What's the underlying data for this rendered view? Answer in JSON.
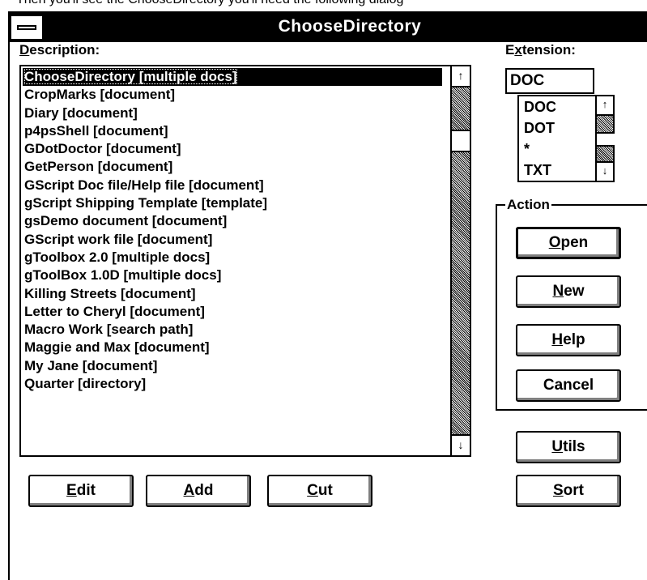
{
  "top_text": "Then you'll see the ChooseDirectory you'll need the following dialog",
  "window": {
    "title": "ChooseDirectory"
  },
  "labels": {
    "description_pre": "",
    "description_key": "D",
    "description_post": "escription:",
    "extension_pre": "E",
    "extension_key": "x",
    "extension_post": "tension:",
    "action": "Action"
  },
  "description_list": {
    "selected_index": 0,
    "items": [
      "ChooseDirectory [multiple docs]",
      "CropMarks [document]",
      "Diary  [document]",
      "p4psShell [document]",
      "GDotDoctor [document]",
      "GetPerson [document]",
      "GScript Doc file/Help file [document]",
      "gScript Shipping Template [template]",
      "gsDemo document [document]",
      "GScript work file [document]",
      "gToolbox 2.0 [multiple docs]",
      "gToolBox 1.0D [multiple docs]",
      "Killing Streets [document]",
      "Letter to Cheryl [document]",
      "Macro Work [search path]",
      "Maggie and Max [document]",
      "My Jane [document]",
      "Quarter [directory]"
    ]
  },
  "extension": {
    "value": "DOC",
    "options": [
      "DOC",
      "DOT",
      "*",
      "TXT"
    ]
  },
  "buttons": {
    "open_key": "O",
    "open_rest": "pen",
    "new_key": "N",
    "new_rest": "ew",
    "help_key": "H",
    "help_rest": "elp",
    "cancel": "Cancel",
    "utils_key": "U",
    "utils_rest": "tils",
    "sort_key": "S",
    "sort_rest": "ort",
    "edit_key": "E",
    "edit_rest": "dit",
    "add_key": "A",
    "add_rest": "dd",
    "cut_key": "C",
    "cut_rest": "ut"
  },
  "icons": {
    "scroll_up": "▲",
    "scroll_down": "▼"
  }
}
